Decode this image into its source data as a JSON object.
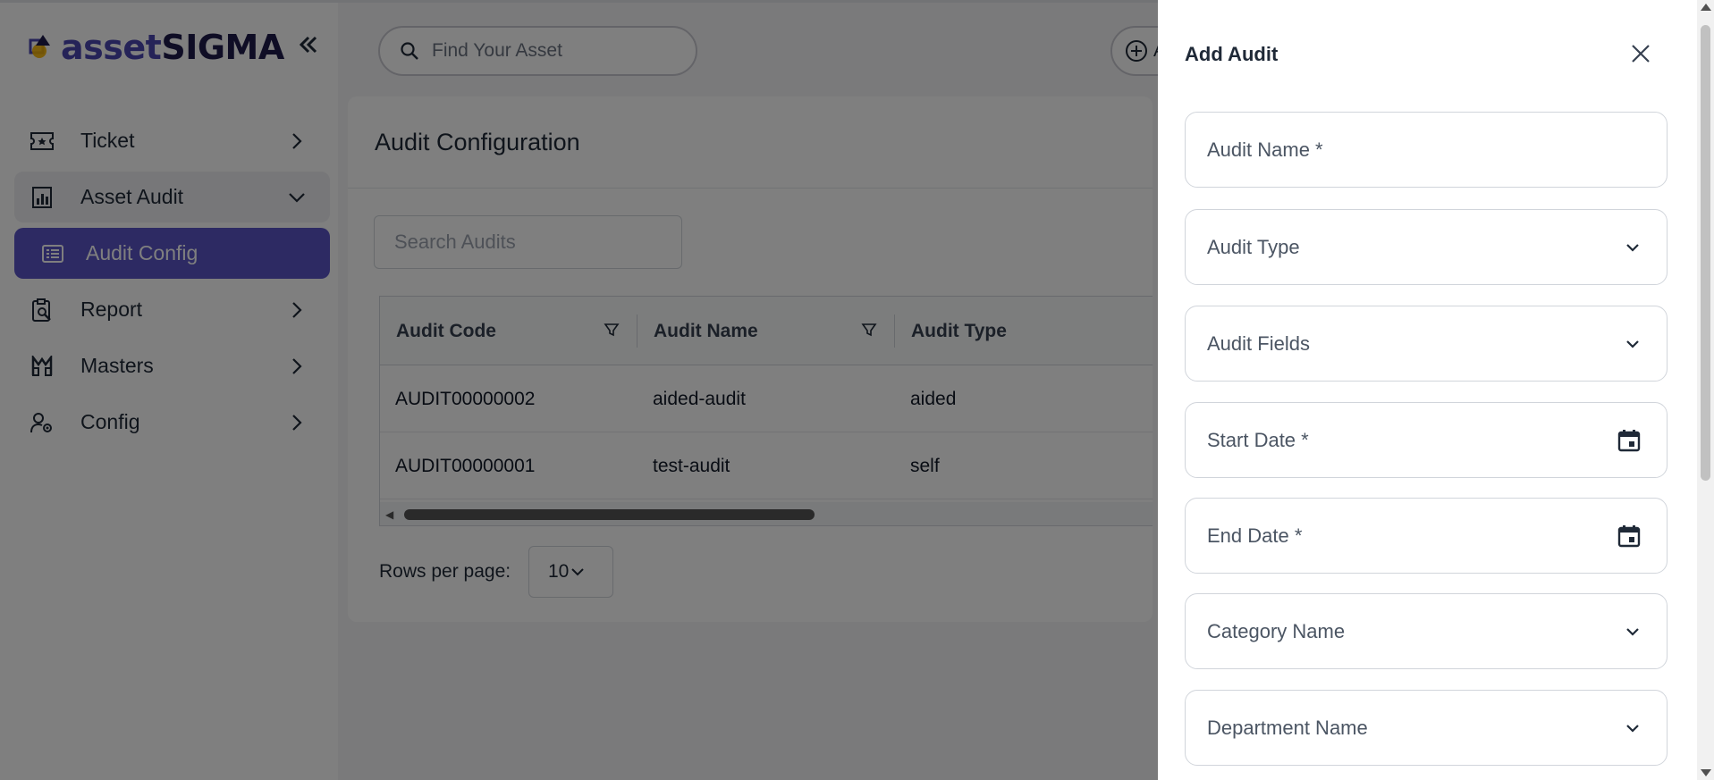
{
  "brand": {
    "logo_part1": "asset",
    "logo_part2": "SIGMA"
  },
  "top": {
    "search_placeholder": "Find Your Asset",
    "add_button_label": "A"
  },
  "sidebar": {
    "items": [
      {
        "label": "Ticket",
        "icon": "ticket-icon"
      },
      {
        "label": "Asset Audit",
        "icon": "audit-chart-icon"
      },
      {
        "label": "Audit Config",
        "icon": "list-icon"
      },
      {
        "label": "Report",
        "icon": "report-icon"
      },
      {
        "label": "Masters",
        "icon": "masters-icon"
      },
      {
        "label": "Config",
        "icon": "user-gear-icon"
      }
    ]
  },
  "main": {
    "title": "Audit Configuration",
    "search_placeholder": "Search Audits",
    "table": {
      "columns": [
        "Audit Code",
        "Audit Name",
        "Audit Type"
      ],
      "rows": [
        [
          "AUDIT00000002",
          "aided-audit",
          "aided"
        ],
        [
          "AUDIT00000001",
          "test-audit",
          "self"
        ]
      ]
    },
    "rows_per_page_label": "Rows per page:",
    "rows_per_page_value": "10"
  },
  "drawer": {
    "title": "Add Audit",
    "fields": {
      "audit_name": "Audit Name *",
      "audit_type": "Audit Type",
      "audit_fields": "Audit Fields",
      "start_date": "Start Date *",
      "end_date": "End Date *",
      "category_name": "Category Name",
      "department_name": "Department Name"
    }
  },
  "colors": {
    "accent": "#5b55c7",
    "brand_dark": "#1e1b4b",
    "overlay": "rgba(0,0,0,0.5)"
  }
}
